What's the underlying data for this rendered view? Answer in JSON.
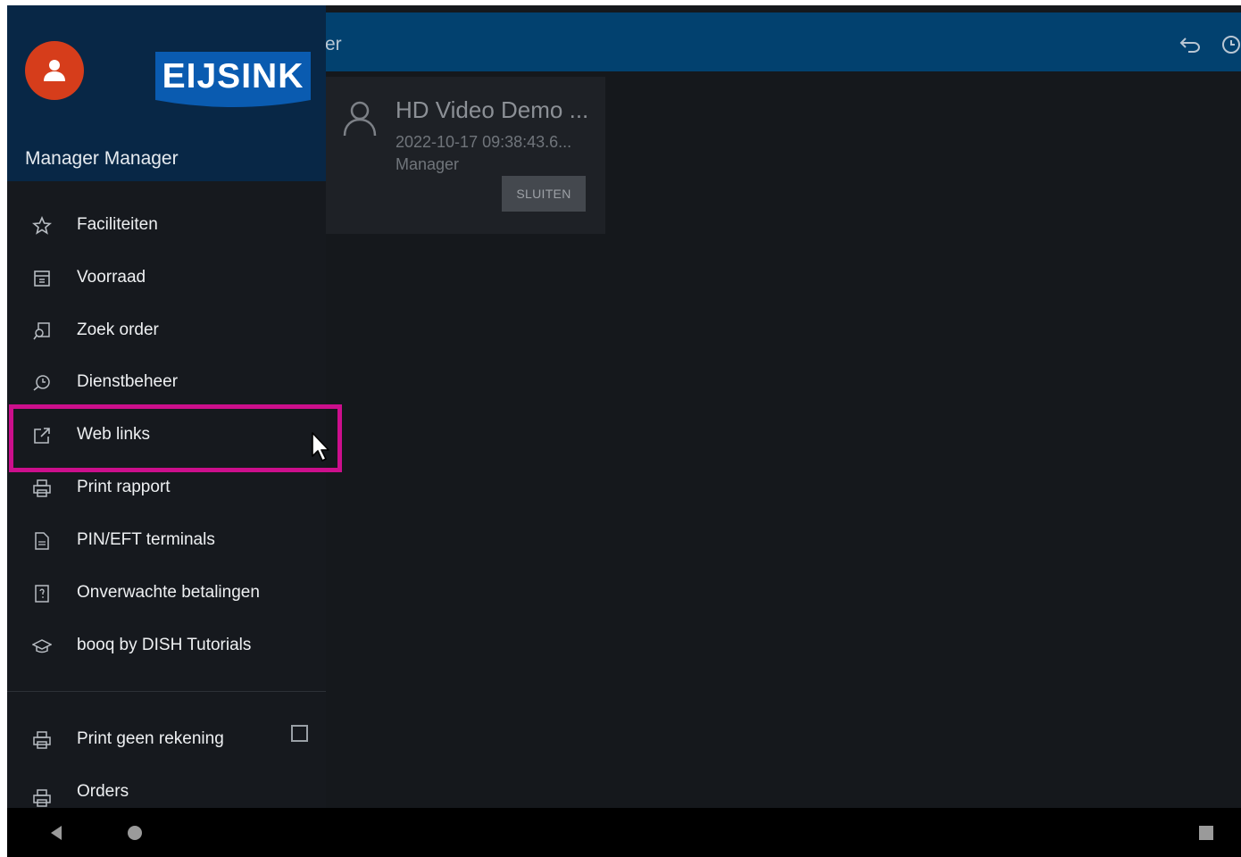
{
  "appbar": {
    "title": "er"
  },
  "card": {
    "title": "HD Video Demo ...",
    "time": "2022-10-17 09:38:43.6...",
    "user": "Manager",
    "close_button": "SLUITEN"
  },
  "drawer": {
    "username": "Manager Manager",
    "logo_text": "EIJSINK",
    "items": [
      {
        "label": "Faciliteiten",
        "icon": "star-icon"
      },
      {
        "label": "Voorraad",
        "icon": "inventory-icon"
      },
      {
        "label": "Zoek order",
        "icon": "search-order-icon"
      },
      {
        "label": "Dienstbeheer",
        "icon": "shift-icon"
      },
      {
        "label": "Web links",
        "icon": "external-link-icon"
      },
      {
        "label": "Print rapport",
        "icon": "printer-icon"
      },
      {
        "label": "PIN/EFT terminals",
        "icon": "document-icon"
      },
      {
        "label": "Onverwachte betalingen",
        "icon": "question-icon"
      },
      {
        "label": "booq by DISH Tutorials",
        "icon": "graduation-icon"
      }
    ],
    "settings": [
      {
        "label": "Print geen rekening",
        "icon": "printer-icon",
        "checked": false
      },
      {
        "label": "Orders",
        "icon": "printer-icon"
      }
    ]
  },
  "colors": {
    "appbar": "#02416f",
    "drawer_header": "#082746",
    "avatar": "#d63d1b",
    "logo": "#0a5bb0",
    "highlight": "#cc0f8c"
  }
}
